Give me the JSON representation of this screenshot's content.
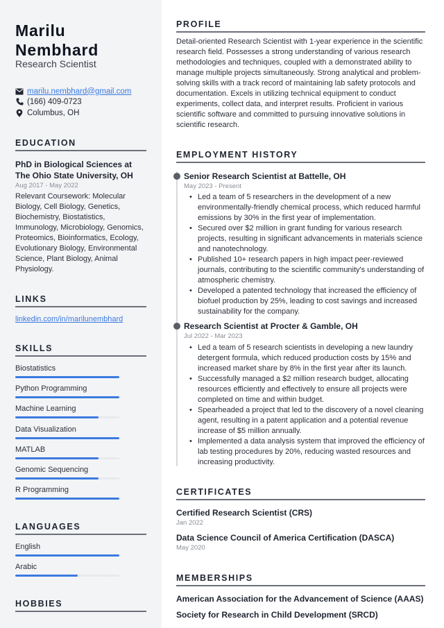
{
  "header": {
    "first_name": "Marilu",
    "last_name": "Nembhard",
    "title": "Research Scientist"
  },
  "contact": {
    "email": "marilu.nembhard@gmail.com",
    "phone": "(166) 409-0723",
    "location": "Columbus, OH",
    "icons": [
      "envelope-icon",
      "phone-icon",
      "map-pin-icon"
    ]
  },
  "education": {
    "heading": "EDUCATION",
    "degree": "PhD in Biological Sciences at The Ohio State University, OH",
    "dates": "Aug 2017 - May 2022",
    "description": "Relevant Coursework: Molecular Biology, Cell Biology, Genetics, Biochemistry, Biostatistics, Immunology, Microbiology, Genomics, Proteomics, Bioinformatics, Ecology, Evolutionary Biology, Environmental Science, Plant Biology, Animal Physiology."
  },
  "links": {
    "heading": "LINKS",
    "items": [
      "linkedin.com/in/marilunembhard"
    ]
  },
  "skills": {
    "heading": "SKILLS",
    "items": [
      {
        "label": "Biostatistics",
        "level": 1.0
      },
      {
        "label": "Python Programming",
        "level": 1.0
      },
      {
        "label": "Machine Learning",
        "level": 0.8
      },
      {
        "label": "Data Visualization",
        "level": 1.0
      },
      {
        "label": "MATLAB",
        "level": 0.8
      },
      {
        "label": "Genomic Sequencing",
        "level": 0.8
      },
      {
        "label": "R Programming",
        "level": 1.0
      }
    ]
  },
  "languages": {
    "heading": "LANGUAGES",
    "items": [
      {
        "label": "English",
        "level": 1.0
      },
      {
        "label": "Arabic",
        "level": 0.6
      }
    ]
  },
  "hobbies": {
    "heading": "HOBBIES"
  },
  "profile": {
    "heading": "PROFILE",
    "text": "Detail-oriented Research Scientist with 1-year experience in the scientific research field. Possesses a strong understanding of various research methodologies and techniques, coupled with a demonstrated ability to manage multiple projects simultaneously. Strong analytical and problem-solving skills with a track record of maintaining lab safety protocols and documentation. Excels in utilizing technical equipment to conduct experiments, collect data, and interpret results. Proficient in various scientific software and committed to pursuing innovative solutions in scientific research."
  },
  "employment": {
    "heading": "EMPLOYMENT HISTORY",
    "jobs": [
      {
        "title": "Senior Research Scientist at Battelle, OH",
        "dates": "May 2023 - Present",
        "bullets": [
          "Led a team of 5 researchers in the development of a new environmentally-friendly chemical process, which reduced harmful emissions by 30% in the first year of implementation.",
          "Secured over $2 million in grant funding for various research projects, resulting in significant advancements in materials science and nanotechnology.",
          "Published 10+ research papers in high impact peer-reviewed journals, contributing to the scientific community's understanding of atmospheric chemistry.",
          "Developed a patented technology that increased the efficiency of biofuel production by 25%, leading to cost savings and increased sustainability for the company."
        ]
      },
      {
        "title": "Research Scientist at Procter & Gamble, OH",
        "dates": "Jul 2022 - Mar 2023",
        "bullets": [
          "Led a team of 5 research scientists in developing a new laundry detergent formula, which reduced production costs by 15% and increased market share by 8% in the first year after its launch.",
          "Successfully managed a $2 million research budget, allocating resources efficiently and effectively to ensure all projects were completed on time and within budget.",
          "Spearheaded a project that led to the discovery of a novel cleaning agent, resulting in a patent application and a potential revenue increase of $5 million annually.",
          "Implemented a data analysis system that improved the efficiency of lab testing procedures by 20%, reducing wasted resources and increasing productivity."
        ]
      }
    ]
  },
  "certificates": {
    "heading": "CERTIFICATES",
    "items": [
      {
        "name": "Certified Research Scientist (CRS)",
        "date": "Jan 2022"
      },
      {
        "name": "Data Science Council of America Certification (DASCA)",
        "date": "May 2020"
      }
    ]
  },
  "memberships": {
    "heading": "MEMBERSHIPS",
    "items": [
      "American Association for the Advancement of Science (AAAS)",
      "Society for Research in Child Development (SRCD)"
    ]
  },
  "colors": {
    "accent": "#3b7ae0",
    "sidebar_bg": "#f3f4f6",
    "muted_text": "#8a8e96"
  }
}
